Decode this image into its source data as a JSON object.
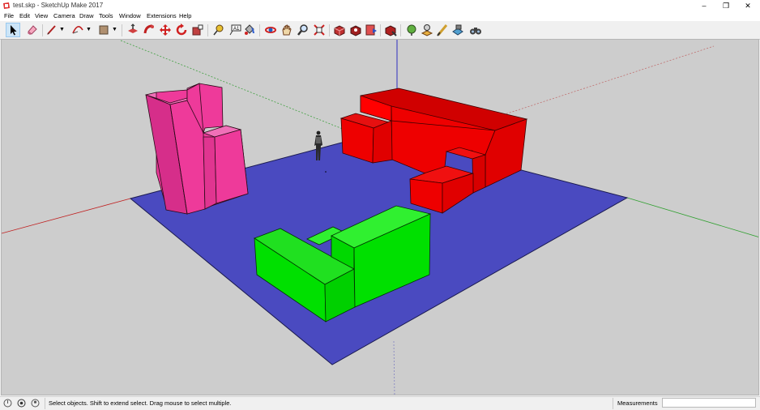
{
  "window": {
    "title": "test.skp - SketchUp Make 2017",
    "minimize_label": "–",
    "maximize_label": "❐",
    "close_label": "✕"
  },
  "menu": {
    "file": "File",
    "edit": "Edit",
    "view": "View",
    "camera": "Camera",
    "draw": "Draw",
    "tools": "Tools",
    "window": "Window",
    "extensions": "Extensions",
    "help": "Help"
  },
  "toolbar": {
    "icons": [
      "select-icon",
      "eraser-icon",
      "line-icon",
      "arc-icon",
      "shape-icon",
      "push-pull-icon",
      "follow-me-icon",
      "move-icon",
      "rotate-icon",
      "scale-icon",
      "tape-measure-icon",
      "text-icon",
      "paint-bucket-icon",
      "orbit-icon",
      "pan-icon",
      "zoom-icon",
      "zoom-extents-icon",
      "3d-warehouse-icon",
      "extension-warehouse-icon",
      "layout-icon",
      "extension-manager-icon",
      "geo-location-icon",
      "add-location-icon",
      "sandbox-icon",
      "photo-match-icon",
      "binoculars-icon"
    ]
  },
  "colors": {
    "sky_ground": "#cdcdcd",
    "ground_plane": "#4a4ac0",
    "pink": "#ee3a9a",
    "red": "#ee0000",
    "green": "#00e000"
  },
  "status": {
    "message": "Select objects. Shift to extend select. Drag mouse to select multiple.",
    "measurements_label": "Measurements",
    "measurements_value": ""
  }
}
